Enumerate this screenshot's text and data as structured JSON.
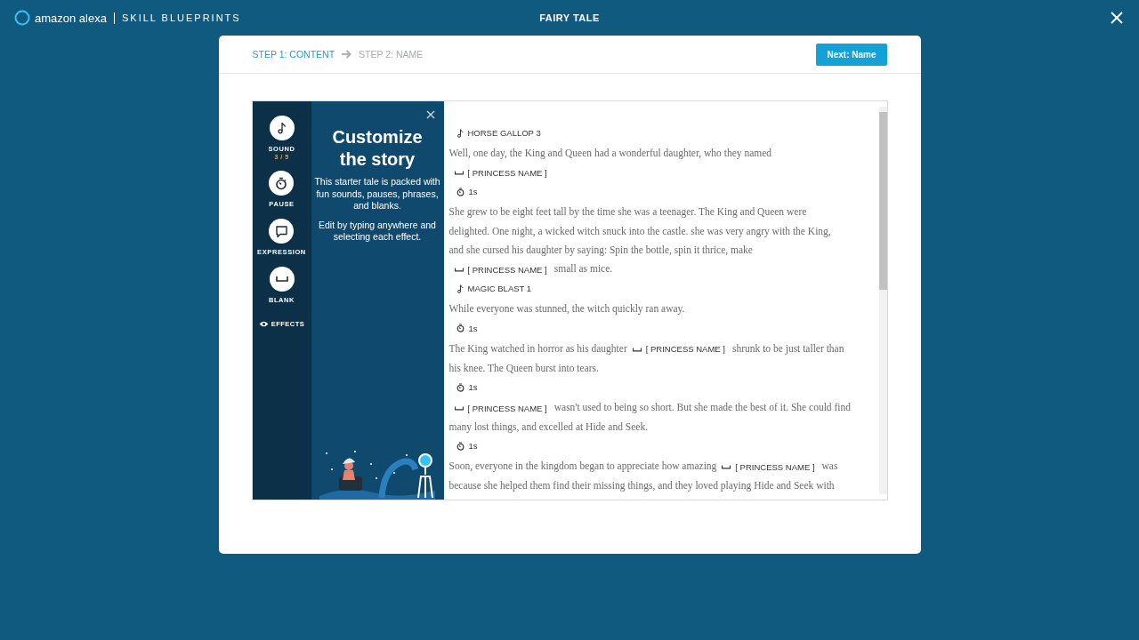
{
  "header": {
    "brand": "amazon alexa",
    "product": "SKILL BLUEPRINTS",
    "title": "FAIRY TALE"
  },
  "steps": [
    {
      "label": "STEP 1: CONTENT",
      "selected": true
    },
    {
      "label": "STEP 2: NAME",
      "selected": false
    }
  ],
  "next_button": "Next: Name",
  "tools": [
    {
      "kind": "sound",
      "label": "SOUND",
      "count": "3 / 5"
    },
    {
      "kind": "pause",
      "label": "PAUSE"
    },
    {
      "kind": "expression",
      "label": "EXPRESSION"
    },
    {
      "kind": "blank",
      "label": "BLANK"
    }
  ],
  "effects_toggle": "EFFECTS",
  "intro": {
    "title": "Customize the story",
    "body": [
      "This starter tale is packed with fun sounds, pauses, phrases, and blanks.",
      "Edit by typing anywhere and selecting each effect."
    ]
  },
  "story": [
    {
      "segments": [
        {
          "kind": "sound",
          "text": "HORSE GALLOP 3"
        }
      ]
    },
    {
      "segments": [
        {
          "kind": "text",
          "text": "Well, one day, the King and Queen had a wonderful daughter, who they named"
        }
      ]
    },
    {
      "segments": [
        {
          "kind": "blank",
          "text": "[ PRINCESS NAME ]"
        }
      ]
    },
    {
      "segments": [
        {
          "kind": "pause",
          "text": "1s"
        }
      ]
    },
    {
      "segments": [
        {
          "kind": "text",
          "text": "She grew to be eight feet tall by the time she was a teenager. The King and Queen were"
        }
      ]
    },
    {
      "segments": [
        {
          "kind": "text",
          "text": "delighted. One night, a wicked witch snuck into the castle. she was very angry with the King,"
        }
      ]
    },
    {
      "segments": [
        {
          "kind": "text",
          "text": "and she cursed his daughter by saying: Spin the bottle, spin it thrice, make"
        }
      ]
    },
    {
      "segments": [
        {
          "kind": "blank",
          "text": "[ PRINCESS NAME ]"
        },
        {
          "kind": "text",
          "text": "small as mice."
        }
      ]
    },
    {
      "segments": [
        {
          "kind": "sound",
          "text": "MAGIC BLAST 1"
        }
      ]
    },
    {
      "segments": [
        {
          "kind": "text",
          "text": "While everyone was stunned, the witch quickly ran away."
        }
      ]
    },
    {
      "segments": [
        {
          "kind": "pause",
          "text": "1s"
        }
      ]
    },
    {
      "segments": [
        {
          "kind": "text",
          "text": "The King watched in horror as his daughter"
        },
        {
          "kind": "blank",
          "text": "[ PRINCESS NAME ]"
        },
        {
          "kind": "text",
          "text": "shrunk to be just taller than"
        }
      ]
    },
    {
      "segments": [
        {
          "kind": "text",
          "text": "his knee. The Queen burst into tears."
        }
      ]
    },
    {
      "segments": [
        {
          "kind": "pause",
          "text": "1s"
        }
      ]
    },
    {
      "segments": [
        {
          "kind": "blank",
          "text": "[ PRINCESS NAME ]"
        },
        {
          "kind": "text",
          "text": "wasn't used to being so short. But she made the best of it. She could find"
        }
      ]
    },
    {
      "segments": [
        {
          "kind": "text",
          "text": "many lost things, and excelled at Hide and Seek."
        }
      ]
    },
    {
      "segments": [
        {
          "kind": "pause",
          "text": "1s"
        }
      ]
    },
    {
      "segments": [
        {
          "kind": "text",
          "text": "Soon, everyone in the kingdom began to appreciate how amazing"
        },
        {
          "kind": "blank",
          "text": "[ PRINCESS NAME ]"
        },
        {
          "kind": "text",
          "text": "was"
        }
      ]
    },
    {
      "segments": [
        {
          "kind": "text",
          "text": "because she helped them find their missing things, and they loved playing Hide and Seek with"
        }
      ]
    }
  ]
}
